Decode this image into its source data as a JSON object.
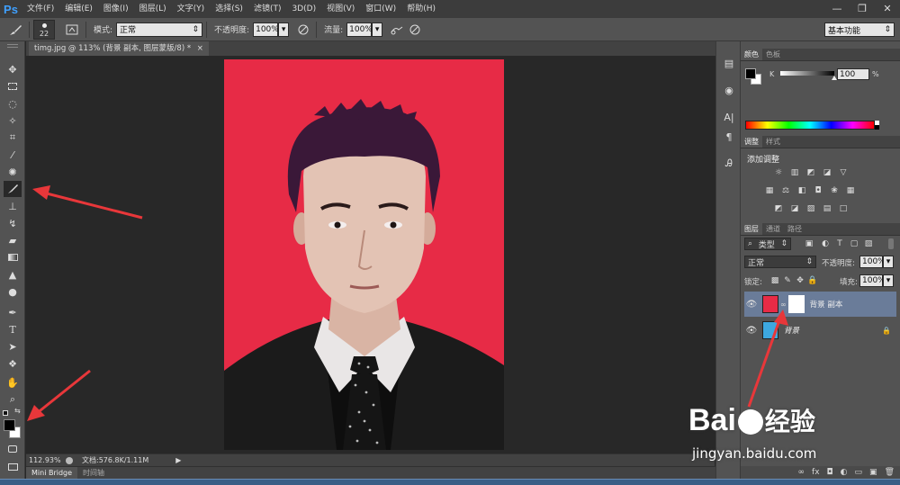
{
  "app": {
    "logo": "Ps"
  },
  "menu": {
    "items": [
      "文件(F)",
      "编辑(E)",
      "图像(I)",
      "图层(L)",
      "文字(Y)",
      "选择(S)",
      "滤镜(T)",
      "3D(D)",
      "视图(V)",
      "窗口(W)",
      "帮助(H)"
    ]
  },
  "window_controls": {
    "minimize": "—",
    "restore": "❐",
    "close": "✕"
  },
  "options": {
    "brush_size": "22",
    "mode_label": "模式:",
    "mode_value": "正常",
    "opacity_label": "不透明度:",
    "opacity_value": "100%",
    "flow_label": "流量:",
    "flow_value": "100%",
    "workspace": "基本功能"
  },
  "document": {
    "tab_title": "timg.jpg @ 113% (背景 副本, 图层蒙版/8) *",
    "tab_close": "×"
  },
  "status": {
    "zoom": "112.93%",
    "doc_info": "文档:576.8K/1.11M"
  },
  "bottom_tabs": [
    "Mini Bridge",
    "时间轴"
  ],
  "panels": {
    "color_tabs": [
      "颜色",
      "色板"
    ],
    "color_channel_label": "K",
    "color_channel_value": "100",
    "color_channel_unit": "%",
    "adjust_tabs": [
      "调整",
      "样式"
    ],
    "adjust_title": "添加调整",
    "layers_tabs": [
      "图层",
      "通道",
      "路径"
    ],
    "filter_kind": "类型",
    "blend_mode": "正常",
    "opacity_label": "不透明度:",
    "opacity_value": "100%",
    "lock_label": "锁定:",
    "fill_label": "填充:",
    "fill_value": "100%",
    "layers": [
      {
        "name": "背景 副本",
        "selected": true,
        "has_mask": true
      },
      {
        "name": "背景",
        "selected": false,
        "locked": true
      }
    ]
  },
  "watermark": {
    "brand": "Bai",
    "brand_cn": "经验",
    "url": "jingyan.baidu.com"
  },
  "colors": {
    "accent": "#3fa0ff",
    "photo_background": "#e72b46",
    "annotation_arrow": "#e8373a",
    "panel": "#535353"
  }
}
